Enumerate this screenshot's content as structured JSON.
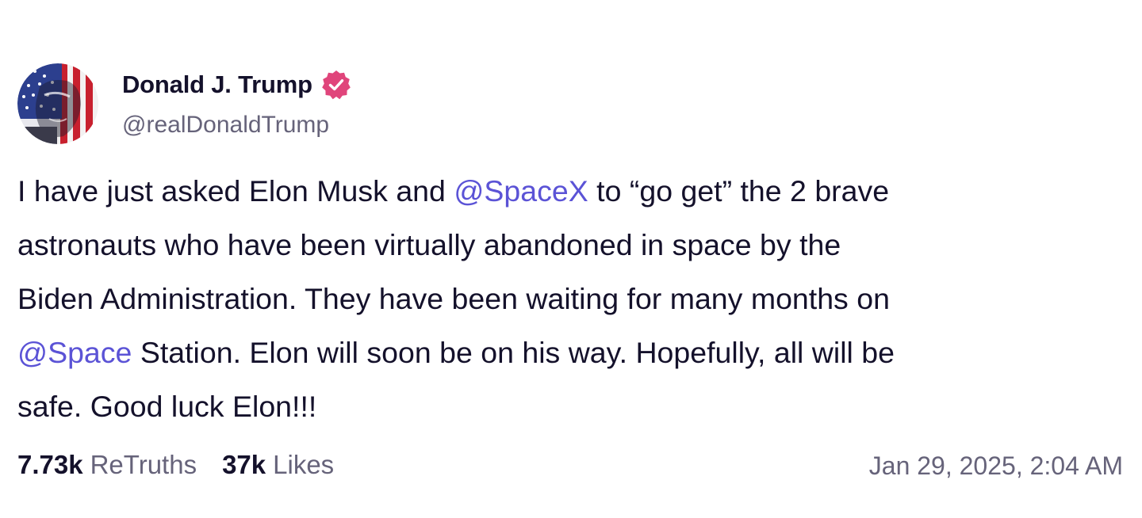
{
  "author": {
    "display_name": "Donald J. Trump",
    "handle": "@realDonaldTrump",
    "avatar_icon": "flag-portrait-avatar",
    "verified_icon": "verified-badge-icon",
    "verified_color": "#e0457b"
  },
  "post": {
    "lines": [
      {
        "before": "I have just asked Elon Musk and ",
        "mention": "@SpaceX",
        "after": " to “go get” the 2 brave"
      },
      {
        "text": "astronauts who have been virtually abandoned in space by the"
      },
      {
        "text": "Biden Administration. They have been waiting for many months on"
      },
      {
        "mention": "@Space",
        "after": " Station. Elon will soon be on his way. Hopefully, all will be"
      },
      {
        "text": "safe. Good luck Elon!!!"
      }
    ],
    "mention_color": "#5b53d6"
  },
  "stats": {
    "retruths_count": "7.73k",
    "retruths_label": "ReTruths",
    "likes_count": "37k",
    "likes_label": "Likes"
  },
  "timestamp": "Jan 29, 2025, 2:04 AM"
}
